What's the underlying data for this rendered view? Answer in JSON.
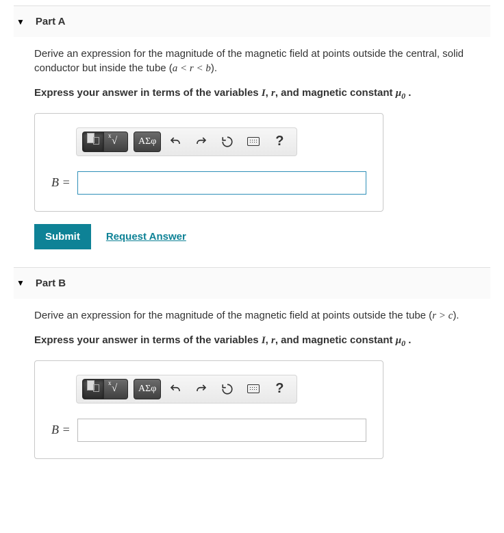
{
  "parts": [
    {
      "title": "Part A",
      "prompt_pre": "Derive an expression for the magnitude of the magnetic field at points outside the central, solid conductor but inside the tube (",
      "prompt_rel": "a < r < b",
      "prompt_post": ").",
      "instruct_pre": "Express your answer in terms of the variables ",
      "instruct_i": "I",
      "instruct_mid1": ", ",
      "instruct_r": "r",
      "instruct_mid2": ", and magnetic constant ",
      "instruct_mu": "μ",
      "instruct_sub": "0",
      "instruct_end": " .",
      "answer_label": "B =",
      "answer_value": "",
      "focused": true,
      "show_actions": true
    },
    {
      "title": "Part B",
      "prompt_pre": "Derive an expression for the magnitude of the magnetic field at points outside the tube (",
      "prompt_rel": "r > c",
      "prompt_post": ").",
      "instruct_pre": "Express your answer in terms of the variables ",
      "instruct_i": "I",
      "instruct_mid1": ", ",
      "instruct_r": "r",
      "instruct_mid2": ", and magnetic constant ",
      "instruct_mu": "μ",
      "instruct_sub": "0",
      "instruct_end": " .",
      "answer_label": "B =",
      "answer_value": "",
      "focused": false,
      "show_actions": false
    }
  ],
  "toolbar": {
    "greek_label": "ΑΣφ",
    "help_label": "?"
  },
  "actions": {
    "submit": "Submit",
    "request": "Request Answer"
  }
}
